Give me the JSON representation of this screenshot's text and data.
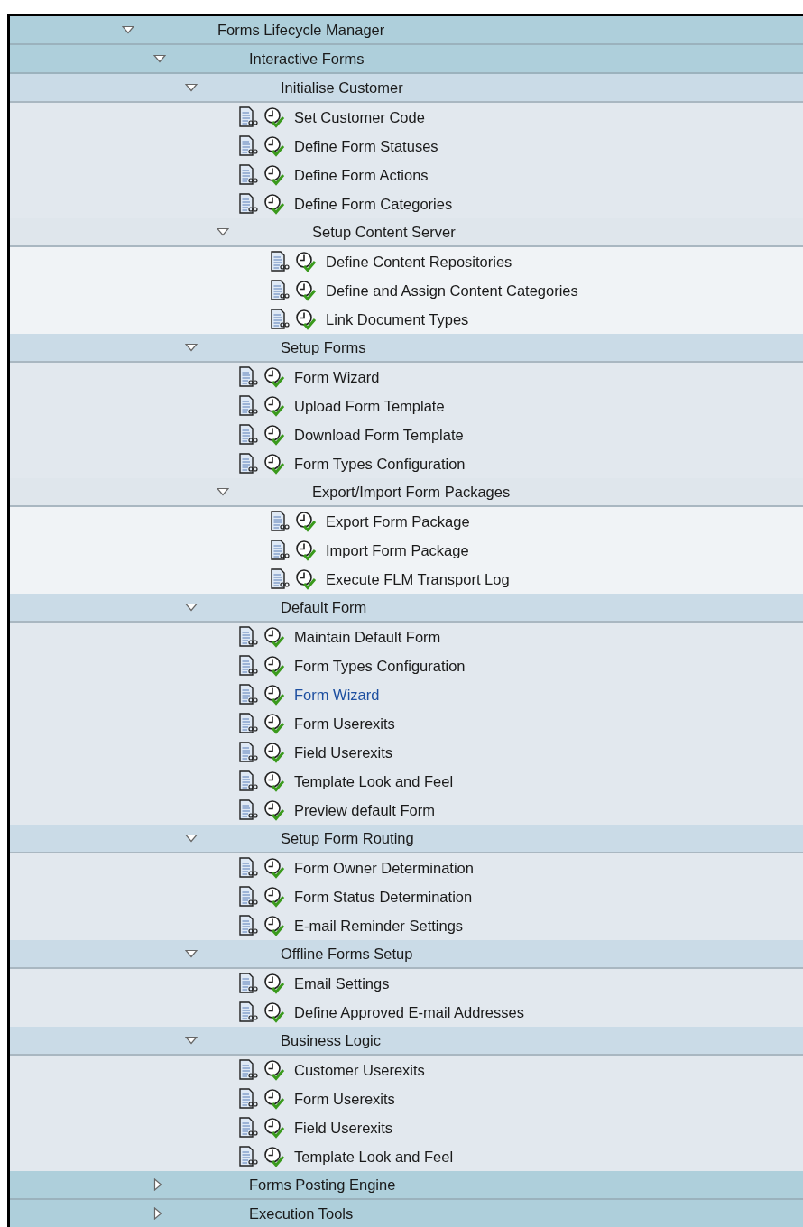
{
  "tree": [
    {
      "kind": "folder",
      "label": "Forms Lifecycle Manager",
      "expanded": true,
      "children": [
        {
          "kind": "folder",
          "label": "Interactive Forms",
          "expanded": true,
          "children": [
            {
              "kind": "folder",
              "label": "Initialise Customer",
              "expanded": true,
              "children": [
                {
                  "kind": "activity",
                  "label": "Set Customer Code",
                  "selected": false
                },
                {
                  "kind": "activity",
                  "label": "Define Form Statuses",
                  "selected": false
                },
                {
                  "kind": "activity",
                  "label": "Define Form Actions",
                  "selected": false
                },
                {
                  "kind": "activity",
                  "label": "Define Form Categories",
                  "selected": false
                },
                {
                  "kind": "folder",
                  "label": "Setup Content Server",
                  "expanded": true,
                  "children": [
                    {
                      "kind": "activity",
                      "label": "Define Content Repositories",
                      "selected": false
                    },
                    {
                      "kind": "activity",
                      "label": "Define and Assign Content Categories",
                      "selected": false
                    },
                    {
                      "kind": "activity",
                      "label": "Link Document Types",
                      "selected": false
                    }
                  ]
                }
              ]
            },
            {
              "kind": "folder",
              "label": "Setup Forms",
              "expanded": true,
              "children": [
                {
                  "kind": "activity",
                  "label": "Form Wizard",
                  "selected": false
                },
                {
                  "kind": "activity",
                  "label": "Upload Form Template",
                  "selected": false
                },
                {
                  "kind": "activity",
                  "label": "Download Form Template",
                  "selected": false
                },
                {
                  "kind": "activity",
                  "label": "Form Types Configuration",
                  "selected": false
                },
                {
                  "kind": "folder",
                  "label": "Export/Import Form Packages",
                  "expanded": true,
                  "children": [
                    {
                      "kind": "activity",
                      "label": "Export Form Package",
                      "selected": false
                    },
                    {
                      "kind": "activity",
                      "label": "Import Form Package",
                      "selected": false
                    },
                    {
                      "kind": "activity",
                      "label": "Execute FLM Transport Log",
                      "selected": false
                    }
                  ]
                }
              ]
            },
            {
              "kind": "folder",
              "label": "Default Form",
              "expanded": true,
              "children": [
                {
                  "kind": "activity",
                  "label": "Maintain Default Form",
                  "selected": false
                },
                {
                  "kind": "activity",
                  "label": "Form Types Configuration",
                  "selected": false
                },
                {
                  "kind": "activity",
                  "label": "Form Wizard",
                  "selected": true
                },
                {
                  "kind": "activity",
                  "label": "Form Userexits",
                  "selected": false
                },
                {
                  "kind": "activity",
                  "label": "Field Userexits",
                  "selected": false
                },
                {
                  "kind": "activity",
                  "label": "Template Look and Feel",
                  "selected": false
                },
                {
                  "kind": "activity",
                  "label": "Preview default Form",
                  "selected": false
                }
              ]
            },
            {
              "kind": "folder",
              "label": "Setup Form Routing",
              "expanded": true,
              "children": [
                {
                  "kind": "activity",
                  "label": "Form Owner Determination",
                  "selected": false
                },
                {
                  "kind": "activity",
                  "label": "Form Status Determination",
                  "selected": false
                },
                {
                  "kind": "activity",
                  "label": "E-mail Reminder Settings",
                  "selected": false
                }
              ]
            },
            {
              "kind": "folder",
              "label": "Offline Forms Setup",
              "expanded": true,
              "children": [
                {
                  "kind": "activity",
                  "label": "Email Settings",
                  "selected": false
                },
                {
                  "kind": "activity",
                  "label": "Define Approved E-mail Addresses",
                  "selected": false
                }
              ]
            },
            {
              "kind": "folder",
              "label": "Business Logic",
              "expanded": true,
              "children": [
                {
                  "kind": "activity",
                  "label": "Customer Userexits",
                  "selected": false
                },
                {
                  "kind": "activity",
                  "label": "Form Userexits",
                  "selected": false
                },
                {
                  "kind": "activity",
                  "label": "Field Userexits",
                  "selected": false
                },
                {
                  "kind": "activity",
                  "label": "Template Look and Feel",
                  "selected": false
                }
              ]
            }
          ]
        },
        {
          "kind": "folder",
          "label": "Forms Posting Engine",
          "expanded": false
        },
        {
          "kind": "folder",
          "label": "Execution Tools",
          "expanded": false
        }
      ]
    }
  ]
}
